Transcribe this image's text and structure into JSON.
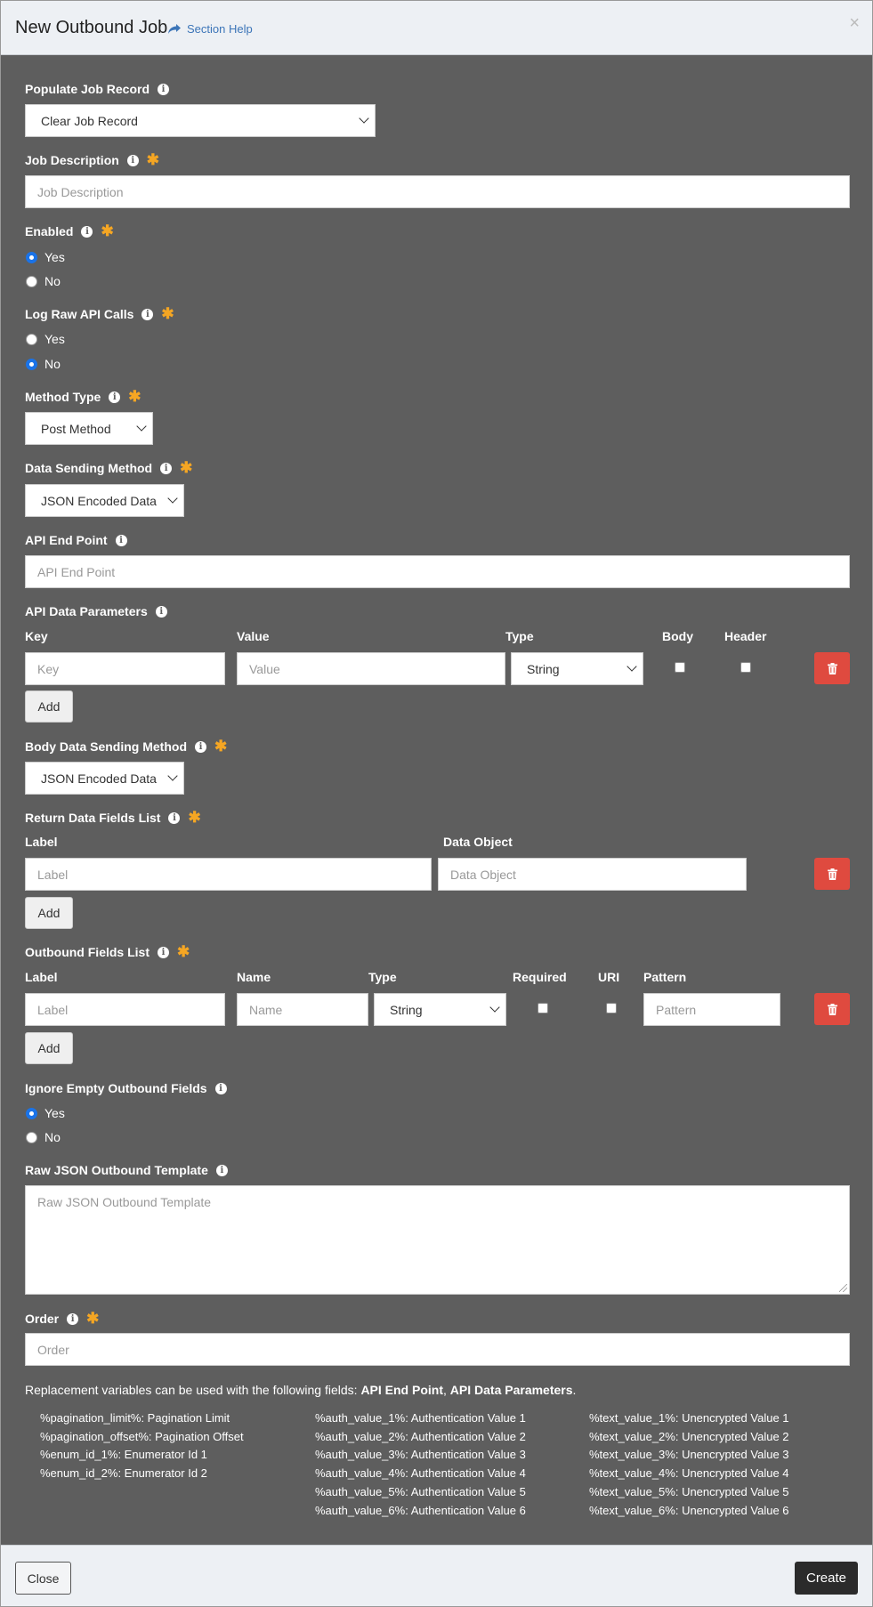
{
  "header": {
    "title": "New Outbound Job",
    "help_label": "Section Help",
    "close_glyph": "×"
  },
  "populate": {
    "label": "Populate Job Record",
    "selected": "Clear Job Record"
  },
  "job_description": {
    "label": "Job Description",
    "placeholder": "Job Description"
  },
  "enabled": {
    "label": "Enabled",
    "yes": "Yes",
    "no": "No",
    "value": "Yes"
  },
  "log_raw": {
    "label": "Log Raw API Calls",
    "yes": "Yes",
    "no": "No",
    "value": "No"
  },
  "method_type": {
    "label": "Method Type",
    "selected": "Post Method"
  },
  "data_sending": {
    "label": "Data Sending Method",
    "selected": "JSON Encoded Data"
  },
  "endpoint": {
    "label": "API End Point",
    "placeholder": "API End Point"
  },
  "api_params": {
    "label": "API Data Parameters",
    "col_key": "Key",
    "col_value": "Value",
    "col_type": "Type",
    "col_body": "Body",
    "col_header": "Header",
    "key_placeholder": "Key",
    "value_placeholder": "Value",
    "type_selected": "String",
    "add_label": "Add"
  },
  "body_sending": {
    "label": "Body Data Sending Method",
    "selected": "JSON Encoded Data"
  },
  "return_fields": {
    "label": "Return Data Fields List",
    "col_label": "Label",
    "col_object": "Data Object",
    "label_placeholder": "Label",
    "object_placeholder": "Data Object",
    "add_label": "Add"
  },
  "outbound_fields": {
    "label": "Outbound Fields List",
    "col_label": "Label",
    "col_name": "Name",
    "col_type": "Type",
    "col_required": "Required",
    "col_uri": "URI",
    "col_pattern": "Pattern",
    "label_placeholder": "Label",
    "name_placeholder": "Name",
    "type_selected": "String",
    "pattern_placeholder": "Pattern",
    "add_label": "Add"
  },
  "ignore_empty": {
    "label": "Ignore Empty Outbound Fields",
    "yes": "Yes",
    "no": "No",
    "value": "Yes"
  },
  "raw_json": {
    "label": "Raw JSON Outbound Template",
    "placeholder": "Raw JSON Outbound Template"
  },
  "order": {
    "label": "Order",
    "placeholder": "Order"
  },
  "note": {
    "prefix": "Replacement variables can be used with the following fields: ",
    "field1": "API End Point",
    "sep": ", ",
    "field2": "API Data Parameters",
    "suffix": "."
  },
  "variables": {
    "col1": [
      "%pagination_limit%: Pagination Limit",
      "%pagination_offset%: Pagination Offset",
      "%enum_id_1%: Enumerator Id 1",
      "%enum_id_2%: Enumerator Id 2"
    ],
    "col2": [
      "%auth_value_1%: Authentication Value 1",
      "%auth_value_2%: Authentication Value 2",
      "%auth_value_3%: Authentication Value 3",
      "%auth_value_4%: Authentication Value 4",
      "%auth_value_5%: Authentication Value 5",
      "%auth_value_6%: Authentication Value 6"
    ],
    "col3": [
      "%text_value_1%: Unencrypted Value 1",
      "%text_value_2%: Unencrypted Value 2",
      "%text_value_3%: Unencrypted Value 3",
      "%text_value_4%: Unencrypted Value 4",
      "%text_value_5%: Unencrypted Value 5",
      "%text_value_6%: Unencrypted Value 6"
    ]
  },
  "footer": {
    "close_label": "Close",
    "create_label": "Create"
  },
  "colors": {
    "required": "#f5a623",
    "delete": "#df4a3f",
    "radio_on": "#1a73e8",
    "link": "#3c75b8"
  }
}
